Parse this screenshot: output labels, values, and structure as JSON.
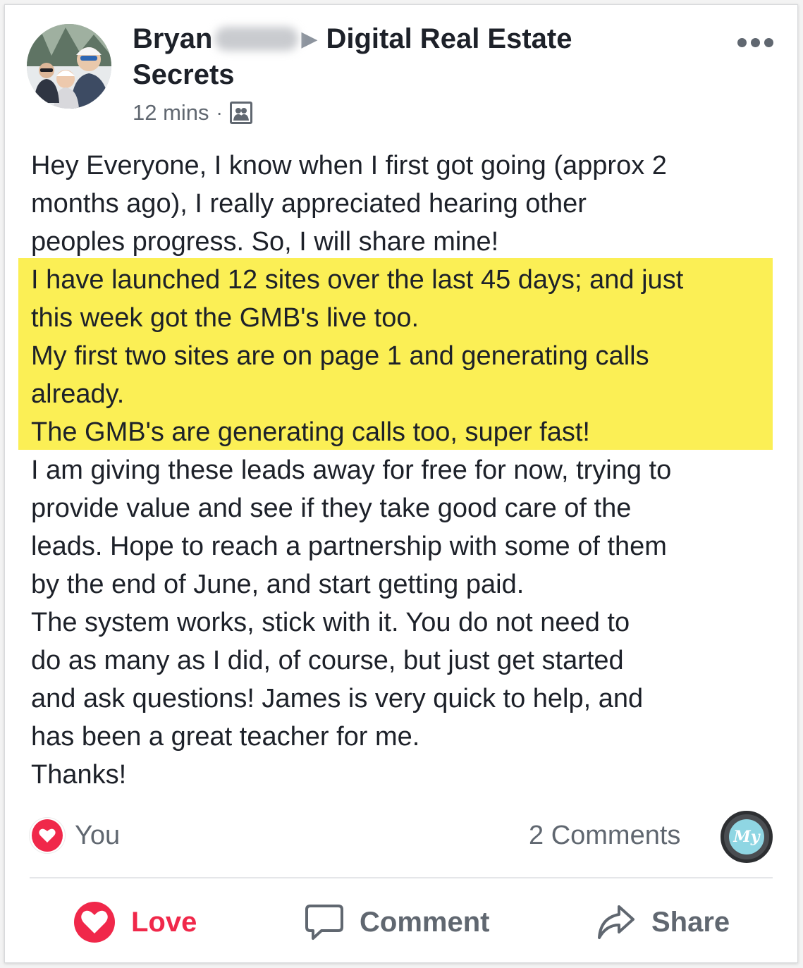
{
  "post": {
    "author": "Bryan",
    "group_line1": "Digital Real Estate",
    "group_line2": "Secrets",
    "time": "12 mins",
    "dot": "·",
    "lines": [
      "Hey Everyone, I know when I first got going (approx 2",
      "months ago), I really appreciated hearing other",
      "peoples progress.  So, I will share mine!",
      "I have launched 12 sites over the last 45 days; and just",
      "this week got the GMB's live too.",
      "My first two sites are on page 1 and generating calls",
      "already.",
      "The GMB's are generating calls too, super fast!",
      "I am giving these leads away for free for now, trying to",
      "provide value and see if they take good care of the",
      "leads.  Hope to reach a partnership with some of them",
      "by the end of June, and start getting paid.",
      "The system works, stick with it.  You do not need to",
      "do as many as I did, of course, but just get started",
      "and ask questions!  James is very quick to help, and",
      "has been a great teacher for me.",
      "Thanks!"
    ]
  },
  "reactions": {
    "who": "You",
    "comments": "2 Comments",
    "commenter_avatar_text": "My"
  },
  "actions": {
    "love": "Love",
    "comment": "Comment",
    "share": "Share"
  },
  "colors": {
    "highlight": "#fbef55",
    "love": "#f0284a",
    "muted": "#606770"
  },
  "icons": [
    "more-icon",
    "group-privacy-icon",
    "heart-icon",
    "comment-icon",
    "share-icon"
  ]
}
